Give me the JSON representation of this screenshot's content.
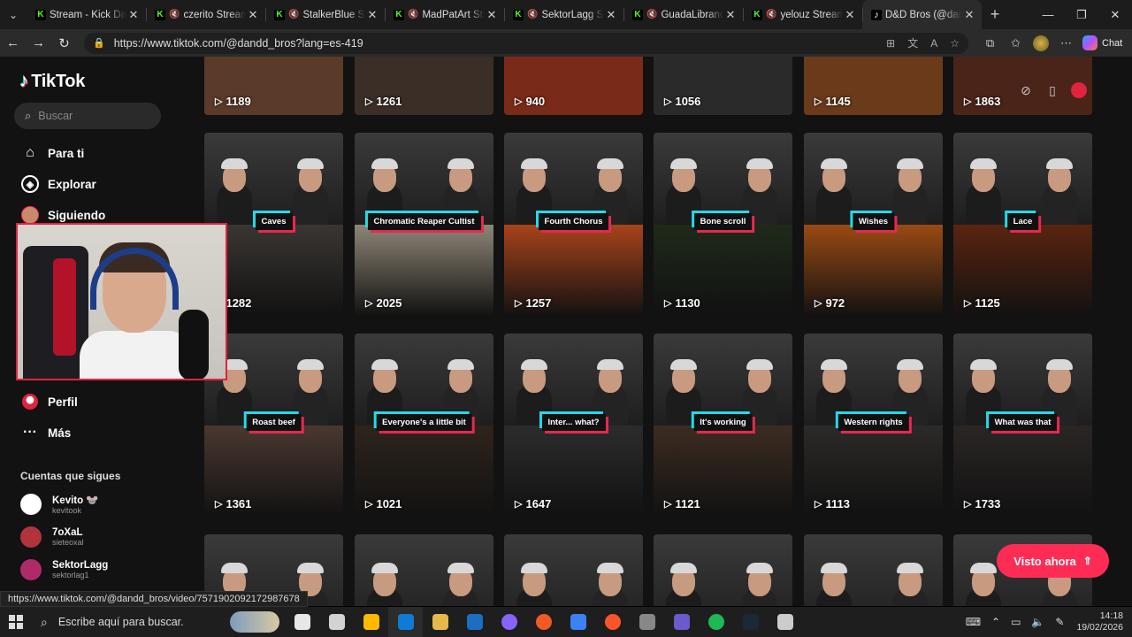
{
  "browser": {
    "tabs": [
      {
        "title": "Stream - Kick Dashboard",
        "icon": "kick",
        "muted": false,
        "active": false
      },
      {
        "title": "czerito Stream - Kick",
        "icon": "kick",
        "muted": true,
        "active": false
      },
      {
        "title": "StalkerBlue Stream",
        "icon": "kick",
        "muted": true,
        "active": false
      },
      {
        "title": "MadPatArt Stream",
        "icon": "kick",
        "muted": true,
        "active": false
      },
      {
        "title": "SektorLagg Stream",
        "icon": "kick",
        "muted": true,
        "active": false
      },
      {
        "title": "GuadaLibrandi Stream",
        "icon": "kick",
        "muted": true,
        "active": false
      },
      {
        "title": "yelouz Stream - Kick",
        "icon": "kick",
        "muted": true,
        "active": false
      },
      {
        "title": "D&D Bros (@dandd_bros)",
        "icon": "tiktok",
        "muted": false,
        "active": true
      }
    ],
    "url": "https://www.tiktok.com/@dandd_bros?lang=es-419",
    "chat_label": "Chat"
  },
  "tiktok": {
    "logo_text": "TikTok",
    "search_placeholder": "Buscar",
    "nav": [
      {
        "label": "Para ti",
        "icon": "home-icon"
      },
      {
        "label": "Explorar",
        "icon": "compass-icon"
      },
      {
        "label": "Siguiendo",
        "icon": "following-avatar"
      },
      {
        "label": "Perfil",
        "icon": "profile-icon"
      },
      {
        "label": "Más",
        "icon": "more-icon"
      }
    ],
    "following_title": "Cuentas que sigues",
    "following": [
      {
        "name": "Kevito 🐭",
        "handle": "kevitook",
        "color": "#ffffff"
      },
      {
        "name": "7oXaL",
        "handle": "sieteoxal",
        "color": "#b0343a"
      },
      {
        "name": "SektorLagg",
        "handle": "sektorlag1",
        "color": "#b02a6a"
      }
    ],
    "videos_row0": [
      "1189",
      "1261",
      "940",
      "1056",
      "1145",
      "1863"
    ],
    "videos": [
      {
        "label": "Caves",
        "views": "1282",
        "bot": "#3a3632"
      },
      {
        "label": "Chromatic Reaper Cultist",
        "views": "2025",
        "bot": "#8e8676"
      },
      {
        "label": "Fourth Chorus",
        "views": "1257",
        "bot": "#a8431a"
      },
      {
        "label": "Bone scroll",
        "views": "1130",
        "bot": "#1f2a1a"
      },
      {
        "label": "Wishes",
        "views": "972",
        "bot": "#9a4a12"
      },
      {
        "label": "Lace",
        "views": "1125",
        "bot": "#5a2410"
      },
      {
        "label": "Roast beef",
        "views": "1361",
        "bot": "#4a3830"
      },
      {
        "label": "Everyone's a little bit",
        "views": "1021",
        "bot": "#2e241c"
      },
      {
        "label": "Inter... what?",
        "views": "1647",
        "bot": "#2c2c2c"
      },
      {
        "label": "It's working",
        "views": "1121",
        "bot": "#3c2c22"
      },
      {
        "label": "Western rights",
        "views": "1113",
        "bot": "#2c2a28"
      },
      {
        "label": "What was that",
        "views": "1733",
        "bot": "#2a2624"
      }
    ],
    "visto_ahora": "Visto ahora",
    "status_url": "https://www.tiktok.com/@dandd_bros/video/7571902092172987678"
  },
  "taskbar": {
    "search_placeholder": "Escribe aquí para buscar.",
    "time": "14:18",
    "date": "19/02/2026",
    "apps": [
      "#e7e7e7",
      "#d3d3d3",
      "#ffb900",
      "#0f7bd4",
      "#e5b94a",
      "#1b6ec2",
      "#8664ff",
      "#f15a24",
      "#3b82f6",
      "#fb542b",
      "#888888",
      "#6a5acd",
      "#1db954",
      "#1b2838",
      "#cccccc"
    ]
  }
}
